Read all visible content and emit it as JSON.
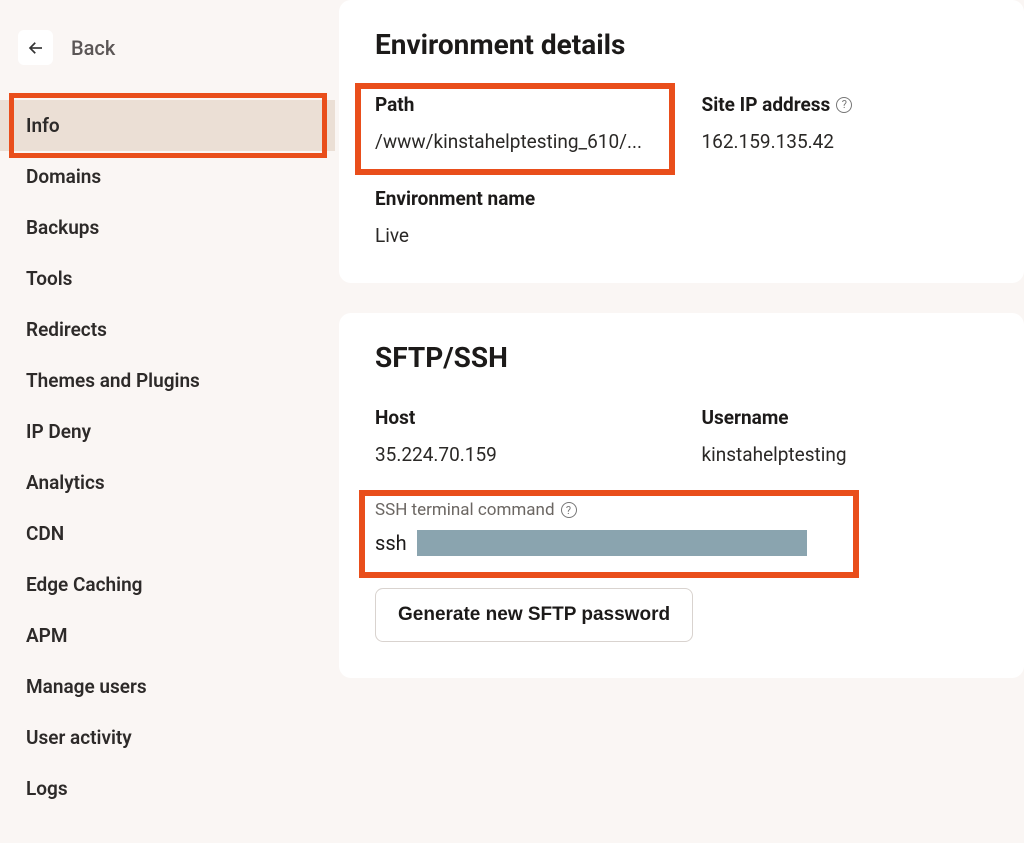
{
  "back_label": "Back",
  "sidebar": {
    "items": [
      {
        "label": "Info",
        "active": true
      },
      {
        "label": "Domains",
        "active": false
      },
      {
        "label": "Backups",
        "active": false
      },
      {
        "label": "Tools",
        "active": false
      },
      {
        "label": "Redirects",
        "active": false
      },
      {
        "label": "Themes and Plugins",
        "active": false
      },
      {
        "label": "IP Deny",
        "active": false
      },
      {
        "label": "Analytics",
        "active": false
      },
      {
        "label": "CDN",
        "active": false
      },
      {
        "label": "Edge Caching",
        "active": false
      },
      {
        "label": "APM",
        "active": false
      },
      {
        "label": "Manage users",
        "active": false
      },
      {
        "label": "User activity",
        "active": false
      },
      {
        "label": "Logs",
        "active": false
      }
    ]
  },
  "env": {
    "title": "Environment details",
    "path_label": "Path",
    "path_value": "/www/kinstahelptesting_610/...",
    "ip_label": "Site IP address",
    "ip_value": "162.159.135.42",
    "env_name_label": "Environment name",
    "env_name_value": "Live"
  },
  "sftp": {
    "title": "SFTP/SSH",
    "host_label": "Host",
    "host_value": "35.224.70.159",
    "user_label": "Username",
    "user_value": "kinstahelptesting",
    "ssh_cmd_label": "SSH terminal command",
    "ssh_cmd_prefix": "ssh",
    "generate_btn": "Generate new SFTP password"
  },
  "colors": {
    "highlight": "#e94e1b",
    "sidebar_active": "#ebdfd5",
    "page_bg": "#faf6f4",
    "redacted": "#8aa4af"
  }
}
